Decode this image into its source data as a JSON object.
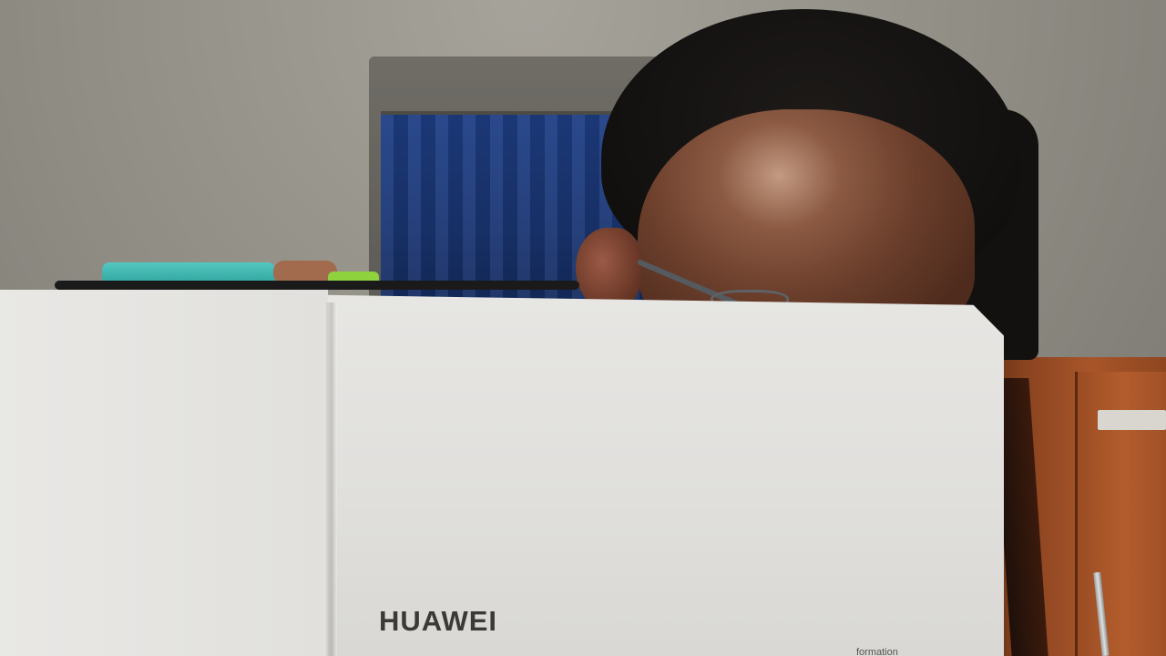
{
  "photo": {
    "box_brand": "HUAWEI",
    "box_subtext": "formation"
  }
}
